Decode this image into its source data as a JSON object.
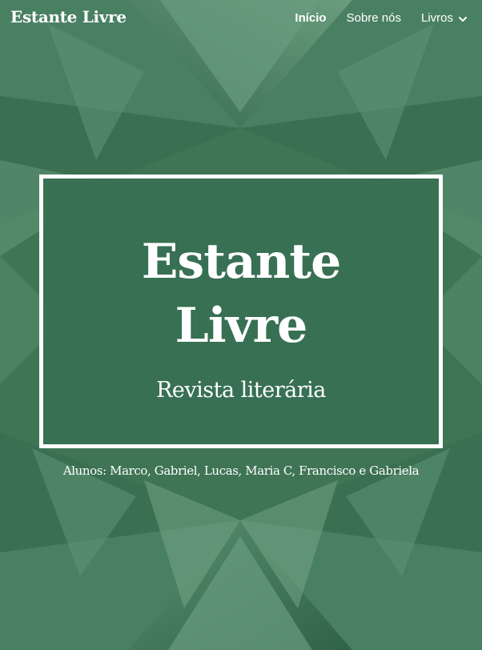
{
  "header": {
    "site_title": "Estante Livre",
    "nav": {
      "home": "Início",
      "about": "Sobre nós",
      "books": "Livros"
    }
  },
  "hero": {
    "title_line1": "Estante",
    "title_line2": "Livre",
    "subtitle": "Revista literária"
  },
  "credits": {
    "students": "Alunos: Marco, Gabriel, Lucas, Maria C, Francisco e Gabriela"
  },
  "colors": {
    "background": "#3f7555",
    "overlay": "#377052",
    "text": "#ffffff"
  },
  "icons": {
    "books_dropdown": "chevron-down-icon"
  }
}
